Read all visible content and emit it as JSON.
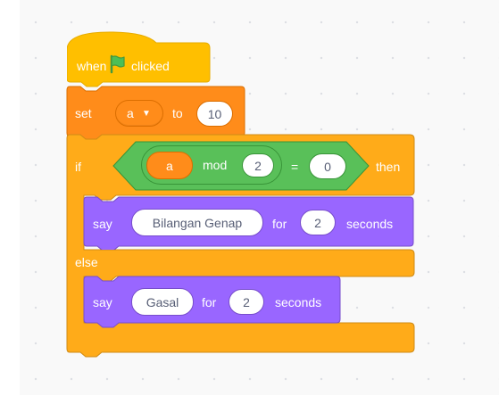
{
  "blocks": {
    "hat": {
      "when_label": "when",
      "flag_icon": "green-flag-icon",
      "clicked_label": "clicked"
    },
    "set": {
      "label": "set",
      "variable": "a",
      "to_label": "to",
      "value": "10"
    },
    "if_else": {
      "if_label": "if",
      "then_label": "then",
      "else_label": "else",
      "condition": {
        "variable": "a",
        "operator_mod": "mod",
        "mod_value": "2",
        "equals_sign": "=",
        "compare_value": "0"
      },
      "say_then": {
        "label": "say",
        "message": "Bilangan Genap",
        "for_label": "for",
        "duration": "2",
        "unit_label": "seconds"
      },
      "say_else": {
        "label": "say",
        "message": "Gasal",
        "for_label": "for",
        "duration": "2",
        "unit_label": "seconds"
      }
    }
  },
  "colors": {
    "events": "#ffbf00",
    "events_dark": "#e6ac00",
    "variables": "#ff8c1a",
    "variables_dark": "#db6e00",
    "control": "#ffab19",
    "control_dark": "#cf8b17",
    "operators": "#59c059",
    "operators_dark": "#389438",
    "looks": "#9966ff",
    "looks_dark": "#774dcb"
  }
}
